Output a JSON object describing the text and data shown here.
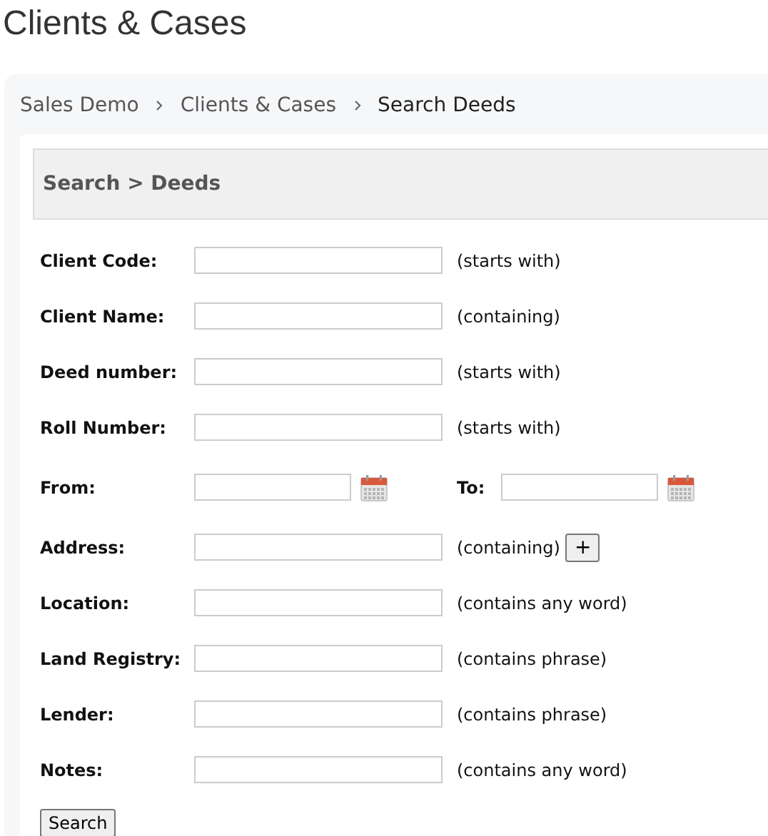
{
  "page_title": "Clients & Cases",
  "breadcrumb": [
    {
      "label": "Sales Demo",
      "current": false
    },
    {
      "label": "Clients & Cases",
      "current": false
    },
    {
      "label": "Search Deeds",
      "current": true
    }
  ],
  "section_title": "Search > Deeds",
  "fields": [
    {
      "kind": "text",
      "label": "Client Code:",
      "hint": "(starts with)"
    },
    {
      "kind": "text",
      "label": "Client Name:",
      "hint": "(containing)"
    },
    {
      "kind": "text",
      "label": "Deed number:",
      "hint": "(starts with)"
    },
    {
      "kind": "text",
      "label": "Roll Number:",
      "hint": "(starts with)"
    },
    {
      "kind": "daterange",
      "label": "From:",
      "label_to": "To:"
    },
    {
      "kind": "text",
      "label": "Address:",
      "hint": "(containing)",
      "add_button": "+"
    },
    {
      "kind": "text",
      "label": "Location:",
      "hint": "(contains any word)"
    },
    {
      "kind": "text",
      "label": "Land Registry:",
      "hint": "(contains phrase)"
    },
    {
      "kind": "text",
      "label": "Lender:",
      "hint": "(contains phrase)"
    },
    {
      "kind": "text",
      "label": "Notes:",
      "hint": "(contains any word)"
    }
  ],
  "search_button": "Search"
}
